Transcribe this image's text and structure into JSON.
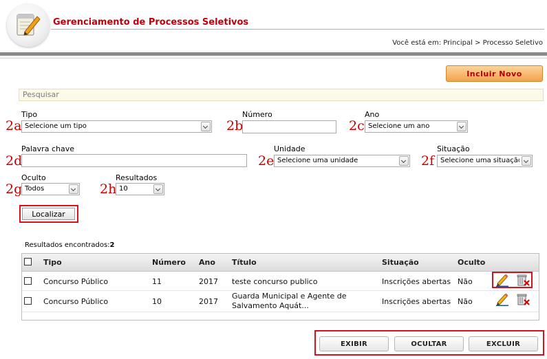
{
  "header": {
    "title": "Gerenciamento de Processos Seletivos",
    "breadcrumb": "Você está em: Principal > Processo Seletivo",
    "logo_icon": "notepad-pencil-icon"
  },
  "toolbar": {
    "new_label": "Incluir Novo"
  },
  "search": {
    "section_title": "Pesquisar",
    "tipo": {
      "label": "Tipo",
      "value": "Selecione um tipo",
      "marker": "2a"
    },
    "numero": {
      "label": "Número",
      "value": "",
      "marker": "2b"
    },
    "ano": {
      "label": "Ano",
      "value": "Selecione um ano",
      "marker": "2c"
    },
    "palavra": {
      "label": "Palavra chave",
      "value": "",
      "marker": "2d"
    },
    "unidade": {
      "label": "Unidade",
      "value": "Selecione uma unidade",
      "marker": "2e"
    },
    "situacao": {
      "label": "Situação",
      "value": "Selecione uma situação",
      "marker": "2f"
    },
    "oculto": {
      "label": "Oculto",
      "value": "Todos",
      "marker": "2g"
    },
    "resultados": {
      "label": "Resultados",
      "value": "10",
      "marker": "2h"
    },
    "find_label": "Localizar"
  },
  "results": {
    "count_label": "Resultados encontrados:",
    "count": "2",
    "columns": [
      "Tipo",
      "Número",
      "Ano",
      "Título",
      "Situação",
      "Oculto"
    ],
    "rows": [
      {
        "tipo": "Concurso Público",
        "numero": "11",
        "ano": "2017",
        "titulo_1": "teste concurso publico",
        "titulo_2": "",
        "situacao": "Inscrições abertas",
        "oculto": "Não"
      },
      {
        "tipo": "Concurso Público",
        "numero": "10",
        "ano": "2017",
        "titulo_1": "Guarda Municipal e Agente de",
        "titulo_2": "Salvamento Aquát...",
        "situacao": "Inscrições abertas",
        "oculto": "Não"
      }
    ],
    "row_icons": [
      "edit-pencil-icon",
      "delete-trash-icon"
    ]
  },
  "actions": {
    "show_label": "EXIBIR",
    "hide_label": "OCULTAR",
    "delete_label": "EXCLUIR"
  },
  "colors": {
    "title_red": "#c0000c",
    "annotation_red": "#cc0000",
    "new_button_orange": "#f3a24c",
    "search_bar_bg": "#fdf9e8"
  }
}
